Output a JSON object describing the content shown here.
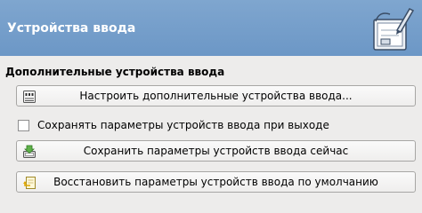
{
  "header": {
    "title": "Устройства ввода",
    "icon": "input-devices-icon"
  },
  "section": {
    "label": "Дополнительные устройства ввода"
  },
  "buttons": {
    "configure": "Настроить дополнительные устройства ввода...",
    "save_now": "Сохранить параметры устройств ввода сейчас",
    "restore_defaults": "Восстановить параметры устройств ввода по умолчанию"
  },
  "options": {
    "save_on_exit_label": "Сохранять параметры устройств ввода при выходе",
    "save_on_exit_checked": false
  },
  "colors": {
    "header_bg": "#6c97c6",
    "header_text": "#ffffff",
    "window_bg": "#edeceb"
  }
}
